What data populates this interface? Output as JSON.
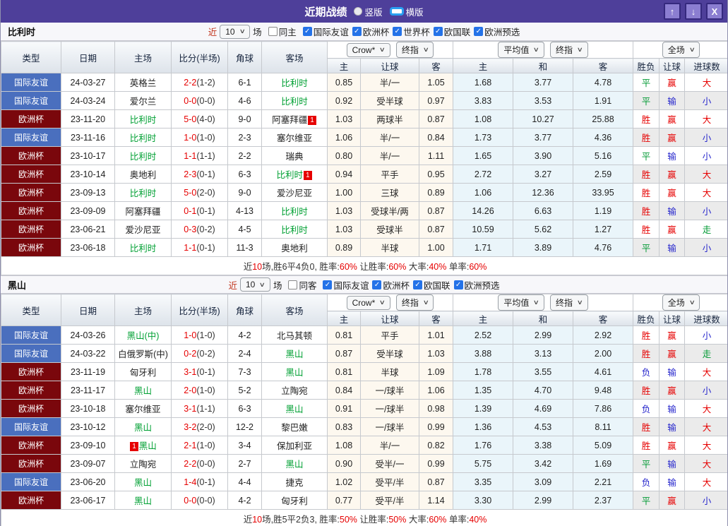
{
  "titlebar": {
    "title": "近期战绩",
    "radio_vertical": "竖版",
    "radio_horizontal": "横版",
    "up_icon": "↑",
    "down_icon": "↓",
    "close_icon": "X"
  },
  "table": {
    "headers": {
      "cols": [
        "类型",
        "日期",
        "主场",
        "比分(半场)",
        "角球",
        "客场"
      ],
      "sub": [
        "主",
        "让球",
        "客",
        "主",
        "和",
        "客",
        "胜负",
        "让球",
        "进球数"
      ]
    },
    "selects": {
      "bookmaker": "Crow*",
      "final1": "终指",
      "average": "平均值",
      "final2": "终指",
      "fullmatch": "全场"
    }
  },
  "result_colors": {
    "胜": "red",
    "平": "green",
    "负": "blue",
    "赢": "red",
    "输": "blue",
    "走": "green",
    "大": "red",
    "小": "blue"
  },
  "colors": {
    "titlebar_purple": "#4e3f9a",
    "type_friendly_blue": "#4a6fbe",
    "type_euro_maroon": "#7a070c",
    "focus_team_green": "#00a033",
    "win_red": "#e60000",
    "lose_blue": "#2626cc",
    "odds_bg": "#fdf8ef",
    "avg_bg": "#eaf5fa"
  },
  "sections": [
    {
      "team": "比利时",
      "filters": {
        "near": "近",
        "count": "10",
        "games": "场",
        "same": "同主",
        "same_checked": false,
        "leagues": [
          "国际友谊",
          "欧洲杯",
          "世界杯",
          "欧国联",
          "欧洲预选"
        ]
      },
      "rows": [
        {
          "type": "国际友谊",
          "tc": "b",
          "date": "24-03-27",
          "home": {
            "n": "英格兰",
            "g": 0
          },
          "ft": "2-2",
          "ht": "(1-2)",
          "corner": "6-1",
          "away": {
            "n": "比利时",
            "g": 1
          },
          "o": [
            "0.85",
            "半/一",
            "1.05"
          ],
          "a": [
            "1.68",
            "3.77",
            "4.78"
          ],
          "r": [
            "平",
            "赢",
            "大"
          ]
        },
        {
          "type": "国际友谊",
          "tc": "b",
          "date": "24-03-24",
          "home": {
            "n": "爱尔兰",
            "g": 0
          },
          "ft": "0-0",
          "ht": "(0-0)",
          "corner": "4-6",
          "away": {
            "n": "比利时",
            "g": 1
          },
          "o": [
            "0.92",
            "受半球",
            "0.97"
          ],
          "a": [
            "3.83",
            "3.53",
            "1.91"
          ],
          "r": [
            "平",
            "输",
            "小"
          ]
        },
        {
          "type": "欧洲杯",
          "tc": "m",
          "date": "23-11-20",
          "home": {
            "n": "比利时",
            "g": 1
          },
          "ft": "5-0",
          "ht": "(4-0)",
          "corner": "9-0",
          "away": {
            "n": "阿塞拜疆",
            "g": 0,
            "b": "1",
            "bp": "a"
          },
          "o": [
            "1.03",
            "两球半",
            "0.87"
          ],
          "a": [
            "1.08",
            "10.27",
            "25.88"
          ],
          "r": [
            "胜",
            "赢",
            "大"
          ]
        },
        {
          "type": "国际友谊",
          "tc": "b",
          "date": "23-11-16",
          "home": {
            "n": "比利时",
            "g": 1
          },
          "ft": "1-0",
          "ht": "(1-0)",
          "corner": "2-3",
          "away": {
            "n": "塞尔维亚",
            "g": 0
          },
          "o": [
            "1.06",
            "半/一",
            "0.84"
          ],
          "a": [
            "1.73",
            "3.77",
            "4.36"
          ],
          "r": [
            "胜",
            "赢",
            "小"
          ]
        },
        {
          "type": "欧洲杯",
          "tc": "m",
          "date": "23-10-17",
          "home": {
            "n": "比利时",
            "g": 1
          },
          "ft": "1-1",
          "ht": "(1-1)",
          "corner": "2-2",
          "away": {
            "n": "瑞典",
            "g": 0
          },
          "o": [
            "0.80",
            "半/一",
            "1.11"
          ],
          "a": [
            "1.65",
            "3.90",
            "5.16"
          ],
          "r": [
            "平",
            "输",
            "小"
          ]
        },
        {
          "type": "欧洲杯",
          "tc": "m",
          "date": "23-10-14",
          "home": {
            "n": "奥地利",
            "g": 0
          },
          "ft": "2-3",
          "ht": "(0-1)",
          "corner": "6-3",
          "away": {
            "n": "比利时",
            "g": 1,
            "b": "1",
            "bp": "a"
          },
          "o": [
            "0.94",
            "平手",
            "0.95"
          ],
          "a": [
            "2.72",
            "3.27",
            "2.59"
          ],
          "r": [
            "胜",
            "赢",
            "大"
          ]
        },
        {
          "type": "欧洲杯",
          "tc": "m",
          "date": "23-09-13",
          "home": {
            "n": "比利时",
            "g": 1
          },
          "ft": "5-0",
          "ht": "(2-0)",
          "corner": "9-0",
          "away": {
            "n": "爱沙尼亚",
            "g": 0
          },
          "o": [
            "1.00",
            "三球",
            "0.89"
          ],
          "a": [
            "1.06",
            "12.36",
            "33.95"
          ],
          "r": [
            "胜",
            "赢",
            "大"
          ]
        },
        {
          "type": "欧洲杯",
          "tc": "m",
          "date": "23-09-09",
          "home": {
            "n": "阿塞拜疆",
            "g": 0
          },
          "ft": "0-1",
          "ht": "(0-1)",
          "corner": "4-13",
          "away": {
            "n": "比利时",
            "g": 1
          },
          "o": [
            "1.03",
            "受球半/两",
            "0.87"
          ],
          "a": [
            "14.26",
            "6.63",
            "1.19"
          ],
          "r": [
            "胜",
            "输",
            "小"
          ]
        },
        {
          "type": "欧洲杯",
          "tc": "m",
          "date": "23-06-21",
          "home": {
            "n": "爱沙尼亚",
            "g": 0
          },
          "ft": "0-3",
          "ht": "(0-2)",
          "corner": "4-5",
          "away": {
            "n": "比利时",
            "g": 1
          },
          "o": [
            "1.03",
            "受球半",
            "0.87"
          ],
          "a": [
            "10.59",
            "5.62",
            "1.27"
          ],
          "r": [
            "胜",
            "赢",
            "走"
          ]
        },
        {
          "type": "欧洲杯",
          "tc": "m",
          "date": "23-06-18",
          "home": {
            "n": "比利时",
            "g": 1
          },
          "ft": "1-1",
          "ht": "(0-1)",
          "corner": "11-3",
          "away": {
            "n": "奥地利",
            "g": 0
          },
          "o": [
            "0.89",
            "半球",
            "1.00"
          ],
          "a": [
            "1.71",
            "3.89",
            "4.76"
          ],
          "r": [
            "平",
            "输",
            "小"
          ]
        }
      ],
      "summary_parts": [
        [
          "近",
          0
        ],
        [
          "10",
          1
        ],
        [
          "场,胜6平4负0, 胜率:",
          0
        ],
        [
          "60%",
          1
        ],
        [
          " 让胜率:",
          0
        ],
        [
          "60%",
          1
        ],
        [
          " 大率:",
          0
        ],
        [
          "40%",
          1
        ],
        [
          " 单率:",
          0
        ],
        [
          "60%",
          1
        ]
      ]
    },
    {
      "team": "黑山",
      "filters": {
        "near": "近",
        "count": "10",
        "games": "场",
        "same": "同客",
        "same_checked": false,
        "leagues": [
          "国际友谊",
          "欧洲杯",
          "欧国联",
          "欧洲预选"
        ]
      },
      "rows": [
        {
          "type": "国际友谊",
          "tc": "b",
          "date": "24-03-26",
          "home": {
            "n": "黑山(中)",
            "g": 1
          },
          "ft": "1-0",
          "ht": "(1-0)",
          "corner": "4-2",
          "away": {
            "n": "北马其顿",
            "g": 0
          },
          "o": [
            "0.81",
            "平手",
            "1.01"
          ],
          "a": [
            "2.52",
            "2.99",
            "2.92"
          ],
          "r": [
            "胜",
            "赢",
            "小"
          ]
        },
        {
          "type": "国际友谊",
          "tc": "b",
          "date": "24-03-22",
          "home": {
            "n": "白俄罗斯(中)",
            "g": 0
          },
          "ft": "0-2",
          "ht": "(0-2)",
          "corner": "2-4",
          "away": {
            "n": "黑山",
            "g": 1
          },
          "o": [
            "0.87",
            "受半球",
            "1.03"
          ],
          "a": [
            "3.88",
            "3.13",
            "2.00"
          ],
          "r": [
            "胜",
            "赢",
            "走"
          ]
        },
        {
          "type": "欧洲杯",
          "tc": "m",
          "date": "23-11-19",
          "home": {
            "n": "匈牙利",
            "g": 0
          },
          "ft": "3-1",
          "ht": "(0-1)",
          "corner": "7-3",
          "away": {
            "n": "黑山",
            "g": 1
          },
          "o": [
            "0.81",
            "半球",
            "1.09"
          ],
          "a": [
            "1.78",
            "3.55",
            "4.61"
          ],
          "r": [
            "负",
            "输",
            "大"
          ]
        },
        {
          "type": "欧洲杯",
          "tc": "m",
          "date": "23-11-17",
          "home": {
            "n": "黑山",
            "g": 1
          },
          "ft": "2-0",
          "ht": "(1-0)",
          "corner": "5-2",
          "away": {
            "n": "立陶宛",
            "g": 0
          },
          "o": [
            "0.84",
            "一/球半",
            "1.06"
          ],
          "a": [
            "1.35",
            "4.70",
            "9.48"
          ],
          "r": [
            "胜",
            "赢",
            "小"
          ]
        },
        {
          "type": "欧洲杯",
          "tc": "m",
          "date": "23-10-18",
          "home": {
            "n": "塞尔维亚",
            "g": 0
          },
          "ft": "3-1",
          "ht": "(1-1)",
          "corner": "6-3",
          "away": {
            "n": "黑山",
            "g": 1
          },
          "o": [
            "0.91",
            "一/球半",
            "0.98"
          ],
          "a": [
            "1.39",
            "4.69",
            "7.86"
          ],
          "r": [
            "负",
            "输",
            "大"
          ]
        },
        {
          "type": "国际友谊",
          "tc": "b",
          "date": "23-10-12",
          "home": {
            "n": "黑山",
            "g": 1
          },
          "ft": "3-2",
          "ht": "(2-0)",
          "corner": "12-2",
          "away": {
            "n": "黎巴嫩",
            "g": 0
          },
          "o": [
            "0.83",
            "一/球半",
            "0.99"
          ],
          "a": [
            "1.36",
            "4.53",
            "8.11"
          ],
          "r": [
            "胜",
            "输",
            "大"
          ]
        },
        {
          "type": "欧洲杯",
          "tc": "m",
          "date": "23-09-10",
          "home": {
            "n": "黑山",
            "g": 1,
            "b": "1",
            "bp": "b"
          },
          "ft": "2-1",
          "ht": "(1-0)",
          "corner": "3-4",
          "away": {
            "n": "保加利亚",
            "g": 0
          },
          "o": [
            "1.08",
            "半/一",
            "0.82"
          ],
          "a": [
            "1.76",
            "3.38",
            "5.09"
          ],
          "r": [
            "胜",
            "赢",
            "大"
          ]
        },
        {
          "type": "欧洲杯",
          "tc": "m",
          "date": "23-09-07",
          "home": {
            "n": "立陶宛",
            "g": 0
          },
          "ft": "2-2",
          "ht": "(0-0)",
          "corner": "2-7",
          "away": {
            "n": "黑山",
            "g": 1
          },
          "o": [
            "0.90",
            "受半/一",
            "0.99"
          ],
          "a": [
            "5.75",
            "3.42",
            "1.69"
          ],
          "r": [
            "平",
            "输",
            "大"
          ]
        },
        {
          "type": "国际友谊",
          "tc": "b",
          "date": "23-06-20",
          "home": {
            "n": "黑山",
            "g": 1
          },
          "ft": "1-4",
          "ht": "(0-1)",
          "corner": "4-4",
          "away": {
            "n": "捷克",
            "g": 0
          },
          "o": [
            "1.02",
            "受平/半",
            "0.87"
          ],
          "a": [
            "3.35",
            "3.09",
            "2.21"
          ],
          "r": [
            "负",
            "输",
            "大"
          ]
        },
        {
          "type": "欧洲杯",
          "tc": "m",
          "date": "23-06-17",
          "home": {
            "n": "黑山",
            "g": 1
          },
          "ft": "0-0",
          "ht": "(0-0)",
          "corner": "4-2",
          "away": {
            "n": "匈牙利",
            "g": 0
          },
          "o": [
            "0.77",
            "受平/半",
            "1.14"
          ],
          "a": [
            "3.30",
            "2.99",
            "2.37"
          ],
          "r": [
            "平",
            "赢",
            "小"
          ]
        }
      ],
      "summary_parts": [
        [
          "近",
          0
        ],
        [
          "10",
          1
        ],
        [
          "场,胜5平2负3, 胜率:",
          0
        ],
        [
          "50%",
          1
        ],
        [
          " 让胜率:",
          0
        ],
        [
          "50%",
          1
        ],
        [
          " 大率:",
          0
        ],
        [
          "60%",
          1
        ],
        [
          " 单率:",
          0
        ],
        [
          "40%",
          1
        ]
      ]
    }
  ]
}
